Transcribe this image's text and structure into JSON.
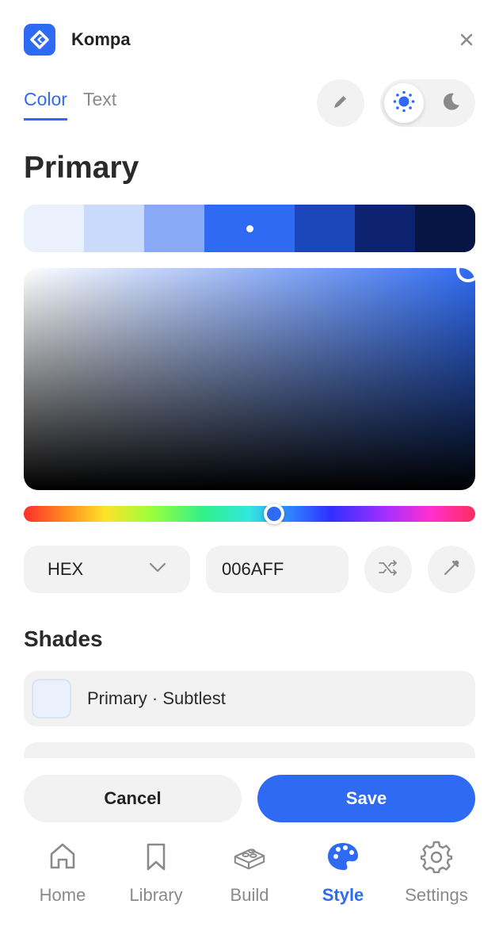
{
  "app": {
    "title": "Kompa",
    "accent": "#2F6BF2"
  },
  "header": {
    "close_icon": "close-icon",
    "logo_icon": "kompa-logo-icon"
  },
  "tabs": [
    {
      "label": "Color",
      "active": true
    },
    {
      "label": "Text",
      "active": false
    }
  ],
  "toolbar": {
    "edit_icon": "pencil-icon",
    "mode": "light",
    "light_icon": "sun-icon",
    "dark_icon": "moon-icon"
  },
  "section": {
    "title": "Primary"
  },
  "swatches": [
    "#EAF1FD",
    "#C9DAFB",
    "#89A9F7",
    "#2F6BF2",
    "#1C47BB",
    "#0C2170",
    "#061544"
  ],
  "selected_swatch_index": 3,
  "picker": {
    "color": "#2F6BF2"
  },
  "format": {
    "selected": "HEX",
    "value": "006AFF"
  },
  "actions": {
    "shuffle_icon": "shuffle-icon",
    "eyedropper_icon": "eyedropper-icon"
  },
  "shades": {
    "title": "Shades",
    "items": [
      {
        "label": "Primary · Subtlest",
        "color": "#EAF1FD"
      },
      {
        "label": "",
        "color": "#C9DAFB"
      }
    ]
  },
  "buttons": {
    "cancel": "Cancel",
    "save": "Save"
  },
  "nav": [
    {
      "label": "Home",
      "icon": "home-icon",
      "active": false
    },
    {
      "label": "Library",
      "icon": "bookmark-icon",
      "active": false
    },
    {
      "label": "Build",
      "icon": "brick-icon",
      "active": false
    },
    {
      "label": "Style",
      "icon": "palette-icon",
      "active": true
    },
    {
      "label": "Settings",
      "icon": "gear-icon",
      "active": false
    }
  ]
}
